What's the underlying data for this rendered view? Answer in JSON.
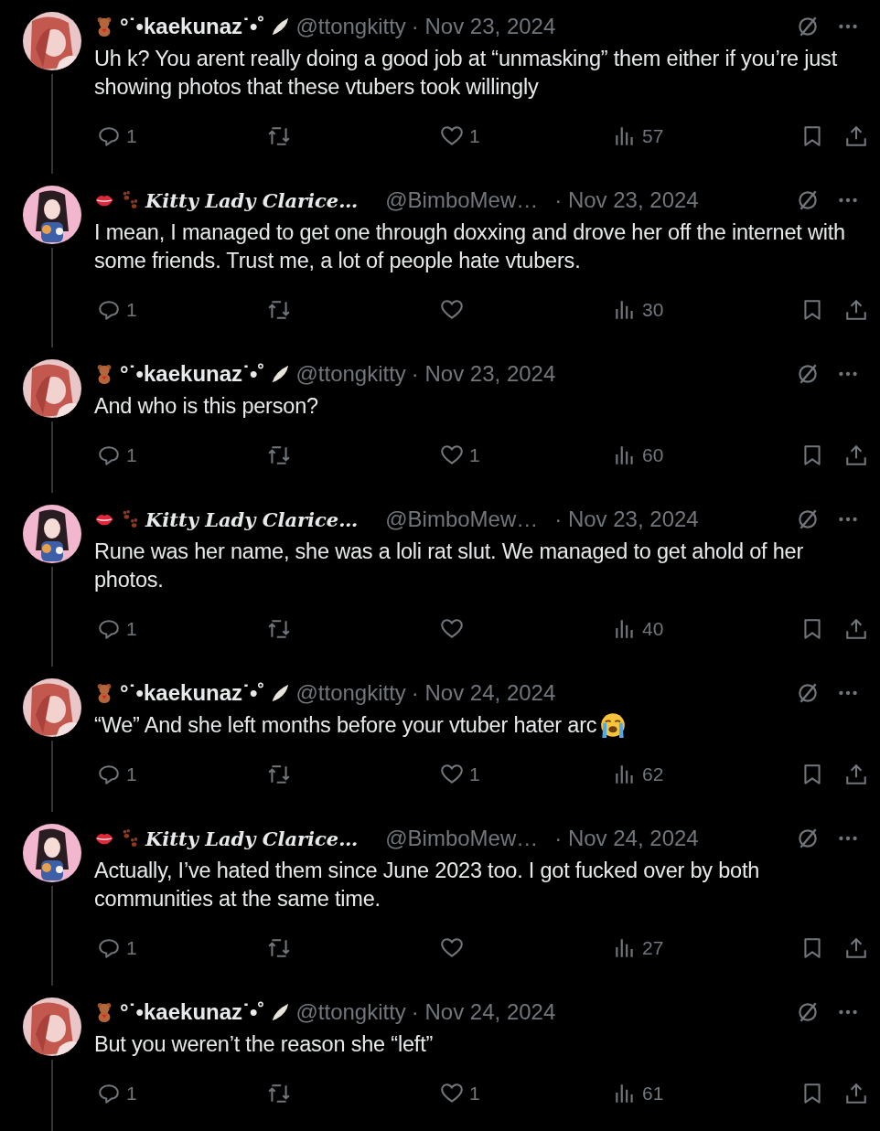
{
  "tweets": [
    {
      "kind": "a",
      "name": "°˙•kaekunaz˙•˚",
      "handle": "@ttongkitty",
      "date": "· Nov 23, 2024",
      "body": "Uh k? You arent really doing a good job at “unmasking” them either if you’re just showing photos that these vtubers took willingly",
      "emoji": false,
      "replies": "1",
      "likes": "1",
      "views": "57"
    },
    {
      "kind": "b",
      "name": "Kitty Lady Clarice…",
      "handle": "@BimboMew…",
      "date": "· Nov 23, 2024",
      "body": "I mean, I managed to get one through doxxing and drove her off the internet with some friends.  Trust me, a lot of people hate vtubers.",
      "emoji": false,
      "replies": "1",
      "views": "30"
    },
    {
      "kind": "a",
      "name": "°˙•kaekunaz˙•˚",
      "handle": "@ttongkitty",
      "date": "· Nov 23, 2024",
      "body": "And who is this person?",
      "emoji": false,
      "replies": "1",
      "likes": "1",
      "views": "60"
    },
    {
      "kind": "b",
      "name": "Kitty Lady Clarice…",
      "handle": "@BimboMew…",
      "date": "· Nov 23, 2024",
      "body": "Rune was her name, she was a loli rat slut.  We managed to get ahold of her photos.",
      "emoji": false,
      "replies": "1",
      "views": "40"
    },
    {
      "kind": "a",
      "name": "°˙•kaekunaz˙•˚",
      "handle": "@ttongkitty",
      "date": "· Nov 24, 2024",
      "body": "“We” And she left months before your vtuber hater arc",
      "emoji": true,
      "replies": "1",
      "likes": "1",
      "views": "62"
    },
    {
      "kind": "b",
      "name": "Kitty Lady Clarice…",
      "handle": "@BimboMew…",
      "date": "· Nov 24, 2024",
      "body": "Actually, I’ve hated them since June 2023 too.  I got fucked over by both communities at the same time.",
      "emoji": false,
      "replies": "1",
      "views": "27"
    },
    {
      "kind": "a",
      "name": "°˙•kaekunaz˙•˚",
      "handle": "@ttongkitty",
      "date": "· Nov 24, 2024",
      "body": "But you weren’t the reason she “left”",
      "emoji": false,
      "replies": "1",
      "likes": "1",
      "views": "61"
    }
  ]
}
